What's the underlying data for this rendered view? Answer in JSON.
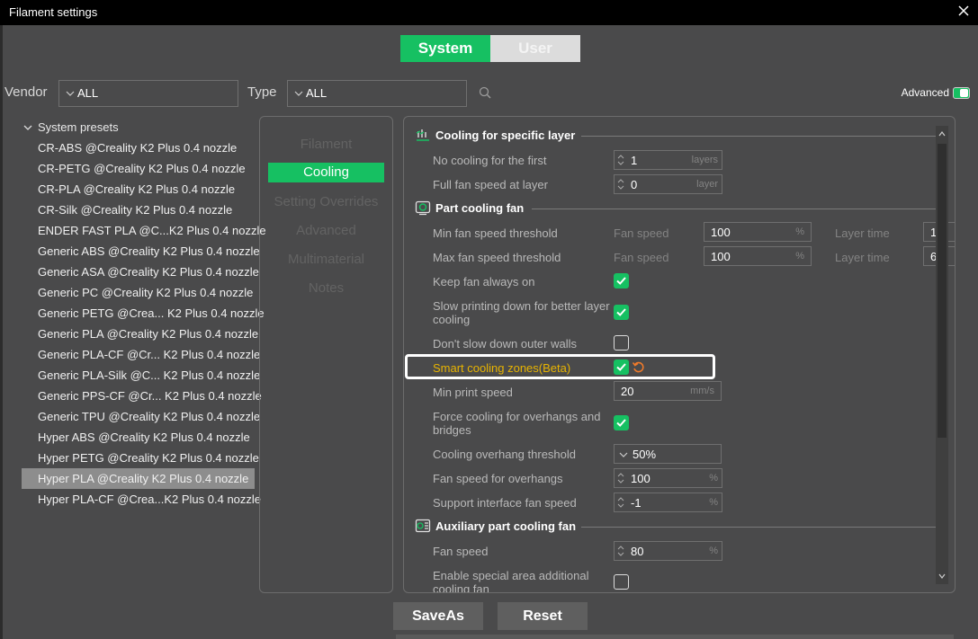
{
  "window": {
    "title": "Filament settings"
  },
  "mode_switch": {
    "system_label": "System",
    "user_label": "User"
  },
  "filters": {
    "vendor_label": "Vendor",
    "vendor_value": "ALL",
    "type_label": "Type",
    "type_value": "ALL",
    "advanced_label": "Advanced"
  },
  "presets": {
    "root_label": "System presets",
    "items": [
      "CR-ABS @Creality K2 Plus 0.4 nozzle",
      "CR-PETG @Creality K2 Plus 0.4 nozzle",
      "CR-PLA @Creality K2 Plus 0.4 nozzle",
      "CR-Silk @Creality K2 Plus 0.4 nozzle",
      "ENDER FAST PLA @C...K2 Plus 0.4 nozzle",
      "Generic ABS @Creality K2 Plus 0.4 nozzle",
      "Generic ASA @Creality K2 Plus 0.4 nozzle",
      "Generic PC @Creality K2 Plus 0.4 nozzle",
      "Generic PETG @Crea... K2 Plus 0.4 nozzle",
      "Generic PLA @Creality K2 Plus 0.4 nozzle",
      "Generic PLA-CF @Cr... K2 Plus 0.4 nozzle",
      "Generic PLA-Silk @C... K2 Plus 0.4 nozzle",
      "Generic PPS-CF @Cr... K2 Plus 0.4 nozzle",
      "Generic TPU @Creality K2 Plus 0.4 nozzle",
      "Hyper ABS @Creality K2 Plus 0.4 nozzle",
      "Hyper PETG @Creality K2 Plus 0.4 nozzle",
      "Hyper PLA @Creality K2 Plus 0.4 nozzle",
      "Hyper PLA-CF @Crea...K2 Plus 0.4 nozzle"
    ],
    "selected": "Hyper PLA @Creality K2 Plus 0.4 nozzle"
  },
  "tabs": {
    "filament": "Filament",
    "cooling": "Cooling",
    "setting_overrides": "Setting Overrides",
    "advanced": "Advanced",
    "multimaterial": "Multimaterial",
    "notes": "Notes",
    "active": "Cooling"
  },
  "cooling_layer": {
    "title": "Cooling for specific layer",
    "no_cooling_label": "No cooling for the first",
    "no_cooling_value": "1",
    "no_cooling_unit": "layers",
    "full_fan_label": "Full fan speed at layer",
    "full_fan_value": "0",
    "full_fan_unit": "layer"
  },
  "part_cooling": {
    "title": "Part cooling fan",
    "fan_speed_sub": "Fan speed",
    "layer_time_sub": "Layer time",
    "percent_unit": "%",
    "min_label": "Min fan speed threshold",
    "min_value": "100",
    "min_layer_time": "1",
    "max_label": "Max fan speed threshold",
    "max_value": "100",
    "max_layer_time": "6",
    "keep_fan_label": "Keep fan always on",
    "keep_fan_checked": true,
    "slow_down_label": "Slow printing down for better layer cooling",
    "slow_down_checked": true,
    "dont_slow_label": "Don't slow down outer walls",
    "dont_slow_checked": false,
    "smart_label": "Smart cooling zones(Beta)",
    "smart_checked": true,
    "min_print_label": "Min print speed",
    "min_print_value": "20",
    "min_print_unit": "mm/s",
    "force_label": "Force cooling for overhangs and bridges",
    "force_checked": true,
    "overhang_threshold_label": "Cooling overhang threshold",
    "overhang_threshold_value": "50%",
    "overhang_fan_label": "Fan speed for overhangs",
    "overhang_fan_value": "100",
    "support_fan_label": "Support interface fan speed",
    "support_fan_value": "-1"
  },
  "aux_fan": {
    "title": "Auxiliary part cooling fan",
    "fan_speed_label": "Fan speed",
    "fan_speed_value": "80",
    "special_area_label": "Enable special area additional cooling fan"
  },
  "footer": {
    "save_as": "SaveAs",
    "reset": "Reset"
  },
  "colors": {
    "accent": "#16c062",
    "highlight_text": "#e8b400",
    "background": "#4a4a4b"
  }
}
